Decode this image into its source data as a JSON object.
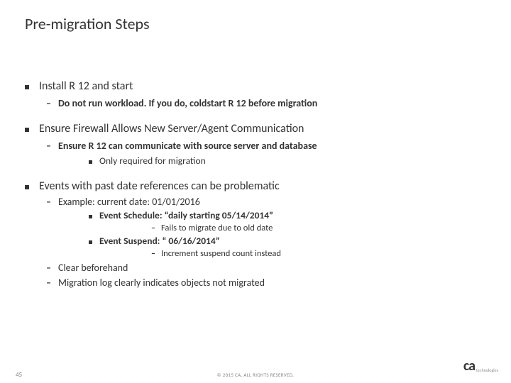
{
  "title": "Pre-migration Steps",
  "bullets": {
    "b1a": "Install R 12 and start",
    "b1a_1": "Do not run workload. If you do, coldstart R 12 before migration",
    "b1b": "Ensure Firewall Allows New Server/Agent Communication",
    "b1b_1": "Ensure R 12 can communicate with source server and database",
    "b1b_1_1": "Only required for migration",
    "b1c": "Events with past date references can be problematic",
    "b1c_1": "Example: current date: 01/01/2016",
    "b1c_1_1": "Event Schedule: “daily starting 05/14/2014”",
    "b1c_1_1_1": "Fails to migrate due to old date",
    "b1c_1_2": "Event Suspend: “ 06/16/2014”",
    "b1c_1_2_1": "Increment suspend count instead",
    "b1c_2": "Clear beforehand",
    "b1c_3": "Migration log clearly indicates objects not migrated"
  },
  "footer": {
    "page": "45",
    "copyright": "© 2015 CA. ALL RIGHTS RESERVED.",
    "logo_main": "ca",
    "logo_sub": "technologies"
  }
}
